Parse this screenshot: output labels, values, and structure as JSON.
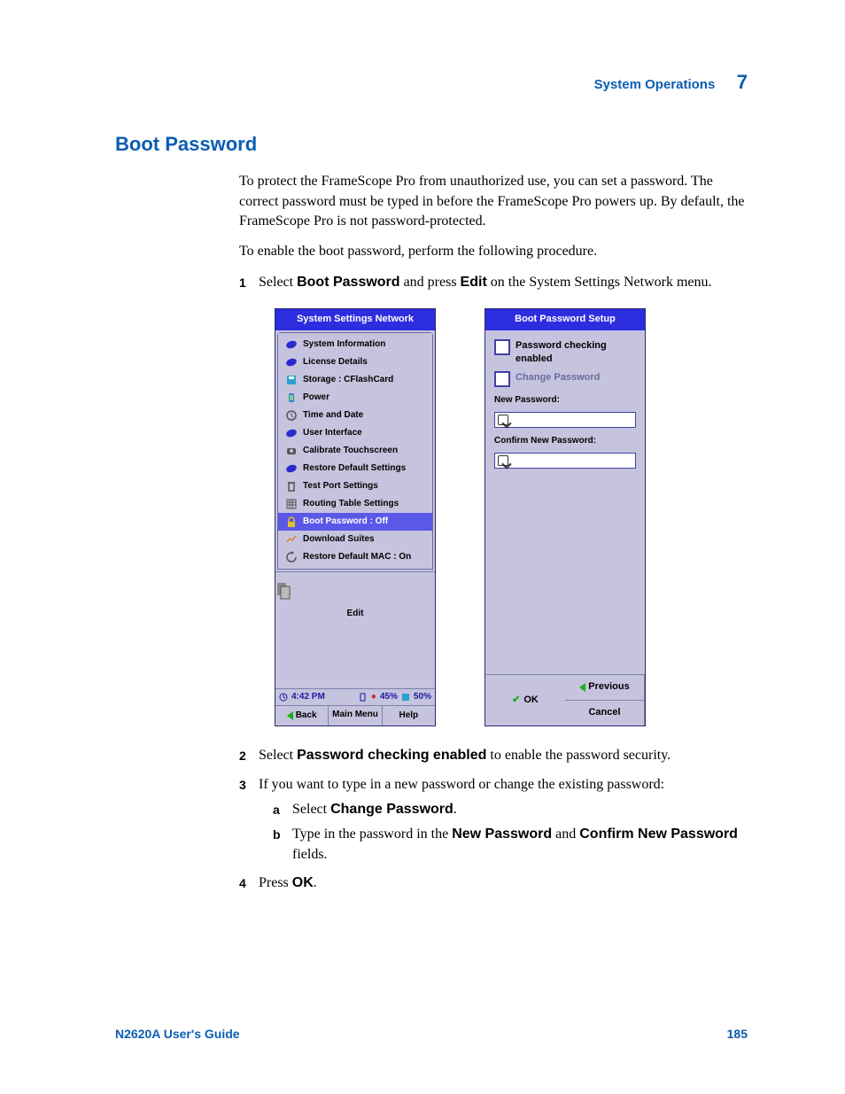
{
  "header": {
    "section": "System Operations",
    "chapter": "7"
  },
  "title": "Boot Password",
  "para1": "To protect the FrameScope Pro from unauthorized use, you can set a password. The correct password must be typed in before the FrameScope Pro powers up. By default, the FrameScope Pro is not password-protected.",
  "para2": "To enable the boot password, perform the following procedure.",
  "step1_pre": "Select ",
  "step1_b1": "Boot Password",
  "step1_mid": " and press ",
  "step1_b2": "Edit",
  "step1_post": " on the System Settings Network menu.",
  "screen1": {
    "title": "System Settings Network",
    "items": [
      "System Information",
      "License Details",
      "Storage : CFlashCard",
      "Power",
      "Time and Date",
      "User Interface",
      "Calibrate Touchscreen",
      "Restore Default Settings",
      "Test Port Settings",
      "Routing Table Settings",
      "Boot Password : Off",
      "Download Suites",
      "Restore Default MAC : On"
    ],
    "edit": "Edit",
    "time": "4:42 PM",
    "pct1": "45%",
    "pct2": "50%",
    "back": "Back",
    "menu": "Main Menu",
    "help": "Help"
  },
  "screen2": {
    "title": "Boot Password Setup",
    "chk1": "Password checking enabled",
    "chk2": "Change Password",
    "newp": "New Password:",
    "conf": "Confirm New Password:",
    "prev": "Previous",
    "ok": "OK",
    "cancel": "Cancel"
  },
  "step2_pre": "Select ",
  "step2_b": "Password checking enabled",
  "step2_post": " to enable the password security.",
  "step3": "If you want to type in a new password or change the existing password:",
  "step3a_pre": "Select ",
  "step3a_b": "Change Password",
  "step3a_post": ".",
  "step3b_pre": "Type in the password in the ",
  "step3b_b1": "New Password",
  "step3b_mid": " and ",
  "step3b_b2": "Confirm New Password",
  "step3b_post": " fields.",
  "step4_pre": "Press ",
  "step4_b": "OK",
  "step4_post": ".",
  "footer": {
    "guide": "N2620A User's Guide",
    "page": "185"
  }
}
